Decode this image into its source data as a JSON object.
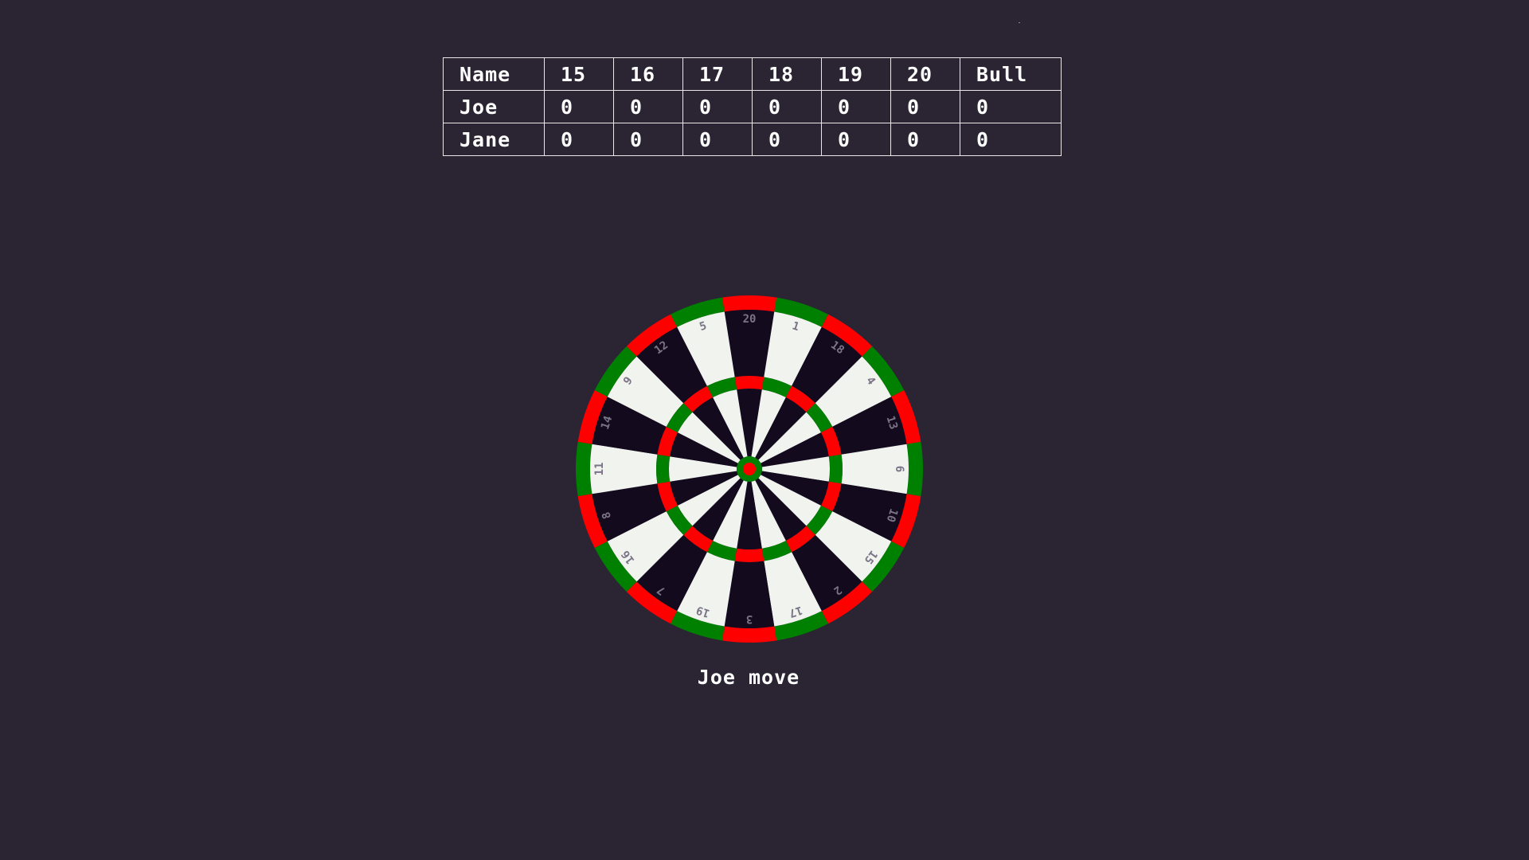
{
  "scoreboard": {
    "headers": [
      "Name",
      "15",
      "16",
      "17",
      "18",
      "19",
      "20",
      "Bull"
    ],
    "rows": [
      {
        "name": "Joe",
        "scores": [
          "0",
          "0",
          "0",
          "0",
          "0",
          "0",
          "0"
        ]
      },
      {
        "name": "Jane",
        "scores": [
          "0",
          "0",
          "0",
          "0",
          "0",
          "0",
          "0"
        ]
      }
    ]
  },
  "dartboard": {
    "numbers_clockwise_from_top": [
      "20",
      "1",
      "18",
      "4",
      "13",
      "6",
      "10",
      "15",
      "2",
      "17",
      "3",
      "19",
      "7",
      "16",
      "8",
      "11",
      "14",
      "9",
      "12",
      "5"
    ],
    "colors": {
      "dark_segment": "#140a1e",
      "light_segment": "#f1f3ef",
      "red": "#ff0000",
      "green": "#008000",
      "number_text": "#7a7486",
      "background": "#2a2433"
    }
  },
  "status": {
    "message": "Joe move"
  }
}
